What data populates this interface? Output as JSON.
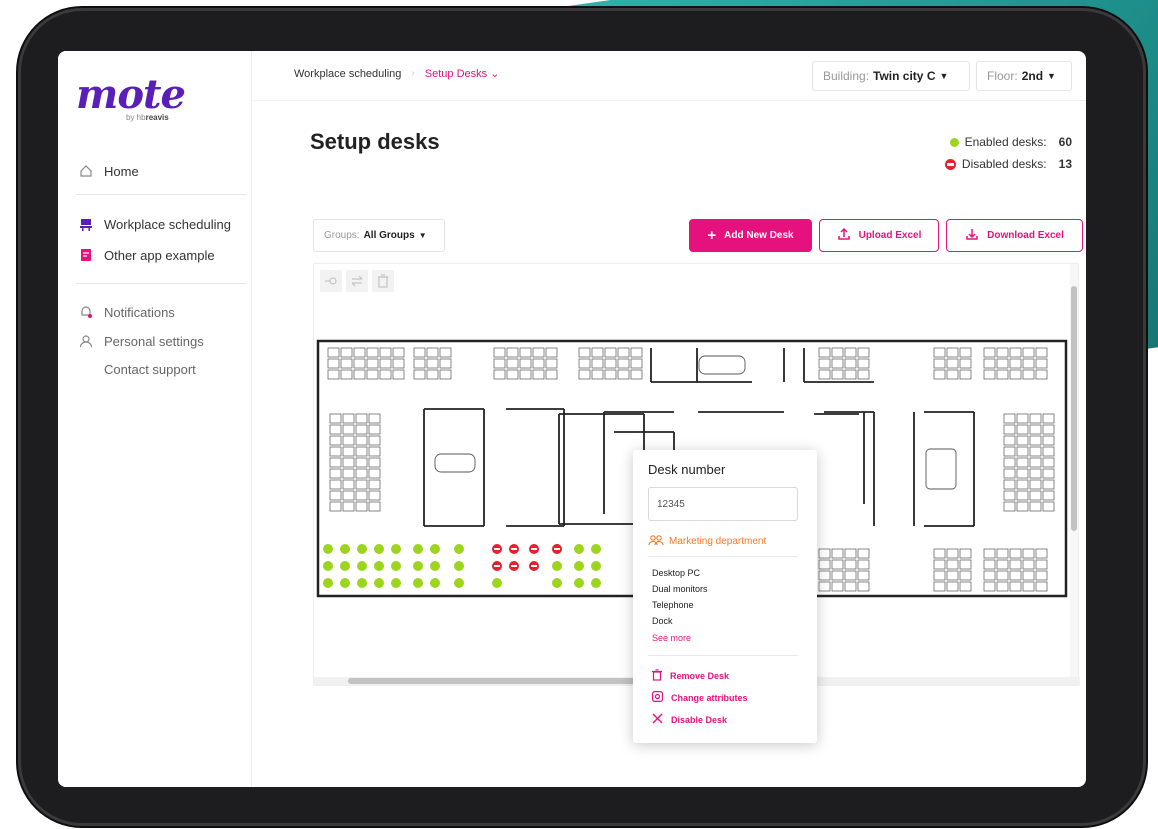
{
  "colors": {
    "brand_purple": "#5a1fb8",
    "accent_pink": "#e5127d",
    "enabled_green": "#9dd41e",
    "disabled_red": "#e5202f",
    "dept_orange": "#f07b2b"
  },
  "logo": {
    "brand": "mote",
    "sub_prefix": "by hb",
    "sub_brand": "reavis"
  },
  "sidebar": {
    "items": [
      {
        "label": "Home",
        "icon": "home-icon"
      },
      {
        "label": "Workplace scheduling",
        "icon": "desk-icon"
      },
      {
        "label": "Other app example",
        "icon": "note-icon"
      },
      {
        "label": "Notifications",
        "icon": "bell-icon"
      },
      {
        "label": "Personal settings",
        "icon": "user-icon"
      },
      {
        "label": "Contact support",
        "icon": ""
      }
    ]
  },
  "breadcrumb": {
    "parent": "Workplace scheduling",
    "current": "Setup Desks"
  },
  "selectors": {
    "building_label": "Building:",
    "building_value": "Twin city C",
    "floor_label": "Floor:",
    "floor_value": "2nd"
  },
  "page": {
    "title": "Setup desks"
  },
  "stats": {
    "enabled_label": "Enabled desks:",
    "enabled_count": "60",
    "disabled_label": "Disabled desks:",
    "disabled_count": "13"
  },
  "toolbar": {
    "groups_label": "Groups:",
    "groups_value": "All Groups",
    "add_label": "Add New Desk",
    "upload_label": "Upload Excel",
    "download_label": "Download Excel"
  },
  "popup": {
    "title": "Desk number",
    "desk_number": "12345",
    "department": "Marketing department",
    "attributes": [
      "Desktop PC",
      "Dual monitors",
      "Telephone",
      "Dock"
    ],
    "see_more": "See more",
    "actions": {
      "remove": "Remove Desk",
      "change": "Change attributes",
      "disable": "Disable Desk"
    }
  }
}
